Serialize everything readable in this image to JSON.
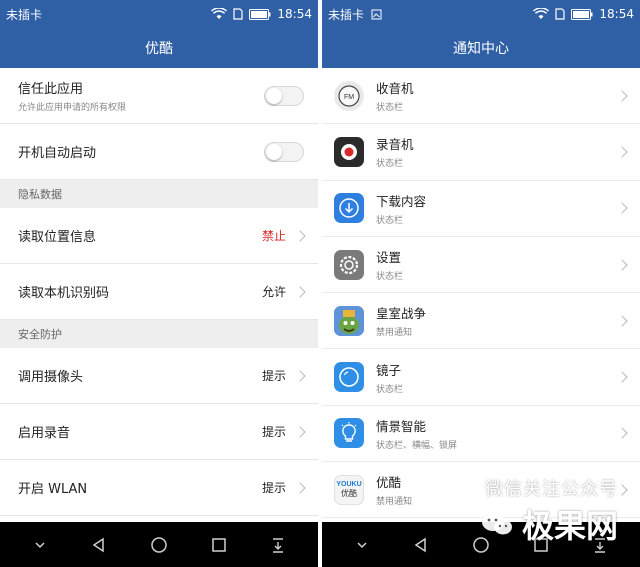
{
  "left": {
    "status": {
      "carrier": "未插卡",
      "time": "18:54"
    },
    "title": "优酷",
    "trust": {
      "title": "信任此应用",
      "sub": "允许此应用申请的所有权限"
    },
    "autostart": {
      "title": "开机自动启动"
    },
    "section_privacy": "隐私数据",
    "location": {
      "title": "读取位置信息",
      "value": "禁止"
    },
    "device_id": {
      "title": "读取本机识别码",
      "value": "允许"
    },
    "section_security": "安全防护",
    "camera": {
      "title": "调用摄像头",
      "value": "提示"
    },
    "record": {
      "title": "启用录音",
      "value": "提示"
    },
    "wlan": {
      "title": "开启 WLAN",
      "value": "提示"
    }
  },
  "right": {
    "status": {
      "carrier": "未插卡",
      "time": "18:54"
    },
    "title": "通知中心",
    "items": [
      {
        "name": "收音机",
        "sub": "状态栏",
        "icon": "fm-radio-icon"
      },
      {
        "name": "录音机",
        "sub": "状态栏",
        "icon": "recorder-icon"
      },
      {
        "name": "下载内容",
        "sub": "状态栏",
        "icon": "download-icon"
      },
      {
        "name": "设置",
        "sub": "状态栏",
        "icon": "settings-gear-icon"
      },
      {
        "name": "皇室战争",
        "sub": "禁用通知",
        "icon": "clash-royale-icon"
      },
      {
        "name": "镜子",
        "sub": "状态栏",
        "icon": "mirror-icon"
      },
      {
        "name": "情景智能",
        "sub": "状态栏、横幅、锁屏",
        "icon": "lightbulb-icon"
      },
      {
        "name": "优酷",
        "sub": "禁用通知",
        "icon": "youku-icon"
      }
    ],
    "youku_logo_top": "YOUKU",
    "youku_logo_bottom": "优酷"
  },
  "watermark": {
    "line1": "微信关注公众号",
    "line2": "极果网"
  },
  "colors": {
    "primary": "#2f5fa4",
    "deny": "#d92a2a",
    "navbar": "#000000"
  }
}
